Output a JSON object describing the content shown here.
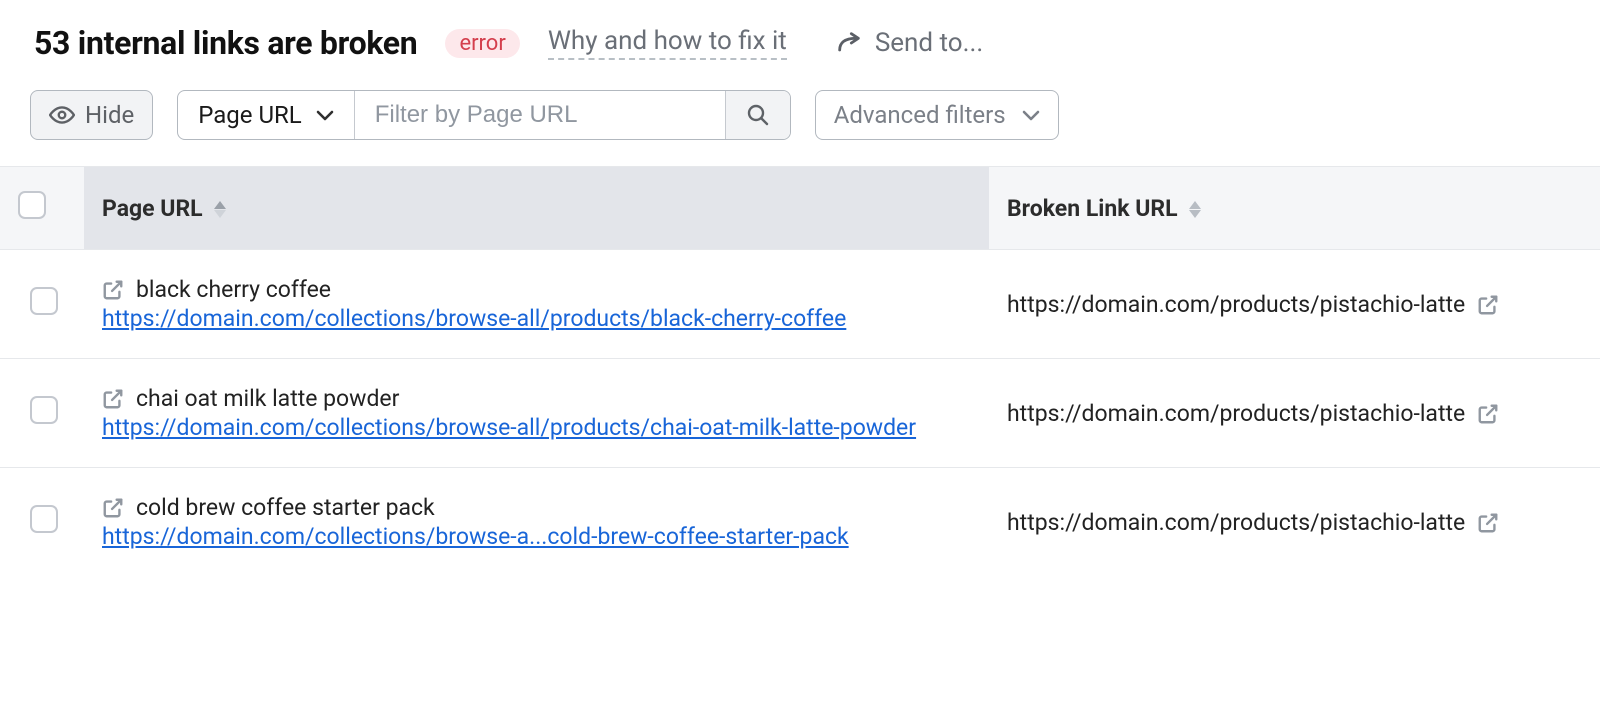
{
  "header": {
    "title": "53 internal links are broken",
    "badge": "error",
    "help_link": "Why and how to fix it",
    "send_to": "Send to..."
  },
  "toolbar": {
    "hide_label": "Hide",
    "filter_column": "Page URL",
    "filter_placeholder": "Filter by Page URL",
    "advanced_filters": "Advanced filters"
  },
  "columns": {
    "page_url": "Page URL",
    "broken_url": "Broken Link URL"
  },
  "rows": [
    {
      "name": "black cherry coffee",
      "url": "https://domain.com/collections/browse-all/products/black-cherry-coffee",
      "broken": "https://domain.com/products/pistachio-latte"
    },
    {
      "name": "chai oat milk latte powder",
      "url": "https://domain.com/collections/browse-all/products/chai-oat-milk-latte-powder",
      "broken": "https://domain.com/products/pistachio-latte"
    },
    {
      "name": "cold brew coffee starter pack",
      "url": "https://domain.com/collections/browse-a...cold-brew-coffee-starter-pack",
      "broken": "https://domain.com/products/pistachio-latte"
    }
  ]
}
